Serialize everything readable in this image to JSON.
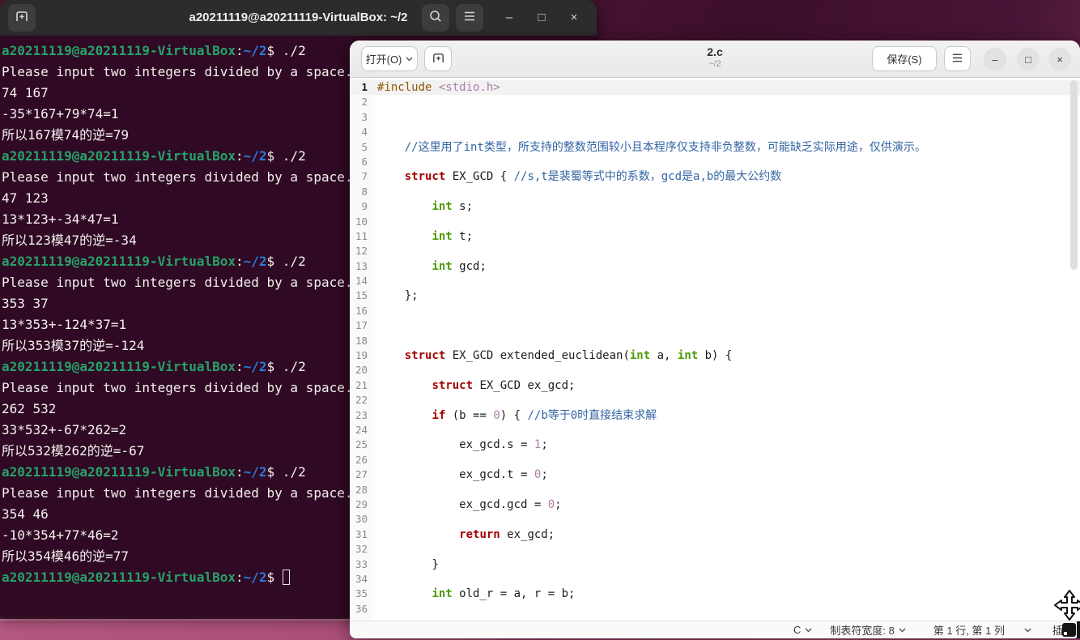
{
  "wallpaper": {
    "base_color": "#451231",
    "accent_light": "#7e335a",
    "strip_left": "#b5587f",
    "strip_right": "#96416b"
  },
  "terminal": {
    "titlebar": {
      "title": "a20211119@a20211119-VirtualBox: ~/2",
      "new_tab_icon": "tab-new",
      "search_icon": "magnifier",
      "menu_icon": "hamburger",
      "minimize_glyph": "–",
      "maximize_glyph": "□",
      "close_glyph": "×"
    },
    "colors": {
      "background": "#300a24",
      "user_host": "#26a269",
      "path": "#2a7bde",
      "text": "#f4f1ee"
    },
    "prompt": {
      "user_host": "a20211119@a20211119-VirtualBox",
      "colon": ":",
      "path": "~/2",
      "dollar": "$"
    },
    "lines": [
      {
        "type": "prompt",
        "command": "./2"
      },
      {
        "type": "output",
        "text": "Please input two integers divided by a space."
      },
      {
        "type": "output",
        "text": "74 167"
      },
      {
        "type": "output",
        "text": "-35*167+79*74=1"
      },
      {
        "type": "output",
        "text": "所以167模74的逆=79"
      },
      {
        "type": "prompt",
        "command": "./2"
      },
      {
        "type": "output",
        "text": "Please input two integers divided by a space."
      },
      {
        "type": "output",
        "text": "47 123"
      },
      {
        "type": "output",
        "text": "13*123+-34*47=1"
      },
      {
        "type": "output",
        "text": "所以123模47的逆=-34"
      },
      {
        "type": "prompt",
        "command": "./2"
      },
      {
        "type": "output",
        "text": "Please input two integers divided by a space."
      },
      {
        "type": "output",
        "text": "353 37"
      },
      {
        "type": "output",
        "text": "13*353+-124*37=1"
      },
      {
        "type": "output",
        "text": "所以353模37的逆=-124"
      },
      {
        "type": "prompt",
        "command": "./2"
      },
      {
        "type": "output",
        "text": "Please input two integers divided by a space."
      },
      {
        "type": "output",
        "text": "262 532"
      },
      {
        "type": "output",
        "text": "33*532+-67*262=2"
      },
      {
        "type": "output",
        "text": "所以532模262的逆=-67"
      },
      {
        "type": "prompt",
        "command": "./2"
      },
      {
        "type": "output",
        "text": "Please input two integers divided by a space."
      },
      {
        "type": "output",
        "text": "354 46"
      },
      {
        "type": "output",
        "text": "-10*354+77*46=2"
      },
      {
        "type": "output",
        "text": "所以354模46的逆=77"
      },
      {
        "type": "prompt_cursor"
      }
    ]
  },
  "editor": {
    "header": {
      "open_button": "打开(O)",
      "new_doc_icon": "tab-new",
      "title": "2.c",
      "subtitle": "~/2",
      "save_button": "保存(S)",
      "menu_icon": "hamburger",
      "minimize_glyph": "–",
      "maximize_glyph": "□",
      "close_glyph": "×"
    },
    "syntax_colors": {
      "keyword": "#a40000",
      "type": "#4e9a06",
      "preprocessor": "#8f5902",
      "include_string": "#ad7fa8",
      "number": "#ad7fa8",
      "comment": "#3465a4",
      "plain": "#1c1c1c"
    },
    "code_lines": [
      [
        [
          "pp",
          "#include"
        ],
        [
          "pl",
          " "
        ],
        [
          "inc",
          "<stdio.h>"
        ]
      ],
      [],
      [],
      [],
      [
        [
          "pl",
          "    "
        ],
        [
          "com",
          "//这里用了int类型，所支持的整数范围较小且本程序仅支持非负整数，可能缺乏实际用途，仅供演示。"
        ]
      ],
      [],
      [
        [
          "pl",
          "    "
        ],
        [
          "kw",
          "struct"
        ],
        [
          "pl",
          " EX_GCD { "
        ],
        [
          "com",
          "//s,t是裴蜀等式中的系数，gcd是a,b的最大公约数"
        ]
      ],
      [],
      [
        [
          "pl",
          "        "
        ],
        [
          "ty",
          "int"
        ],
        [
          "pl",
          " s;"
        ]
      ],
      [],
      [
        [
          "pl",
          "        "
        ],
        [
          "ty",
          "int"
        ],
        [
          "pl",
          " t;"
        ]
      ],
      [],
      [
        [
          "pl",
          "        "
        ],
        [
          "ty",
          "int"
        ],
        [
          "pl",
          " gcd;"
        ]
      ],
      [],
      [
        [
          "pl",
          "    };"
        ]
      ],
      [],
      [],
      [],
      [
        [
          "pl",
          "    "
        ],
        [
          "kw",
          "struct"
        ],
        [
          "pl",
          " EX_GCD extended_euclidean("
        ],
        [
          "ty",
          "int"
        ],
        [
          "pl",
          " a, "
        ],
        [
          "ty",
          "int"
        ],
        [
          "pl",
          " b) {"
        ]
      ],
      [],
      [
        [
          "pl",
          "        "
        ],
        [
          "kw",
          "struct"
        ],
        [
          "pl",
          " EX_GCD ex_gcd;"
        ]
      ],
      [],
      [
        [
          "pl",
          "        "
        ],
        [
          "kw",
          "if"
        ],
        [
          "pl",
          " (b == "
        ],
        [
          "num",
          "0"
        ],
        [
          "pl",
          ") { "
        ],
        [
          "com",
          "//b等于0时直接结束求解"
        ]
      ],
      [],
      [
        [
          "pl",
          "            ex_gcd.s = "
        ],
        [
          "num",
          "1"
        ],
        [
          "pl",
          ";"
        ]
      ],
      [],
      [
        [
          "pl",
          "            ex_gcd.t = "
        ],
        [
          "num",
          "0"
        ],
        [
          "pl",
          ";"
        ]
      ],
      [],
      [
        [
          "pl",
          "            ex_gcd.gcd = "
        ],
        [
          "num",
          "0"
        ],
        [
          "pl",
          ";"
        ]
      ],
      [],
      [
        [
          "pl",
          "            "
        ],
        [
          "kw",
          "return"
        ],
        [
          "pl",
          " ex_gcd;"
        ]
      ],
      [],
      [
        [
          "pl",
          "        }"
        ]
      ],
      [],
      [
        [
          "pl",
          "        "
        ],
        [
          "ty",
          "int"
        ],
        [
          "pl",
          " old_r = a, r = b;"
        ]
      ],
      []
    ],
    "statusbar": {
      "language": "C",
      "tab_width": "制表符宽度: 8",
      "cursor_position": "第 1 行, 第 1 列",
      "insert_mode": "插入"
    }
  }
}
